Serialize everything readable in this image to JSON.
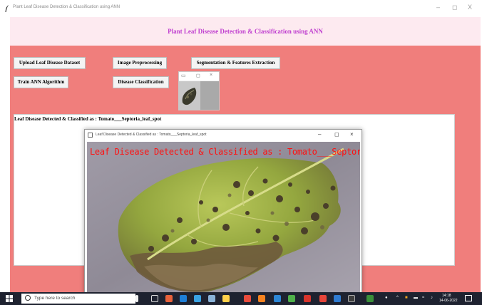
{
  "window": {
    "title": "Plant Leaf Disease Detection & Classification using ANN",
    "minimize": "–",
    "maximize": "◻",
    "close": "X"
  },
  "header": {
    "heading": "Plant Leaf Disease Detection & Classification using ANN"
  },
  "buttons": {
    "upload": "Upload Leaf Disease Dataset",
    "preprocess": "Image Preprocessing",
    "segmentation": "Segmentation & Features Extraction",
    "train": "Train ANN Algorithm",
    "classify": "Disease Classification"
  },
  "result": {
    "label": "Leaf Disease Detected & Classified as : Tomato___Septoria_leaf_spot"
  },
  "mini_window": {
    "minimize": "▭",
    "maximize": "◻",
    "close": "×"
  },
  "image_window": {
    "title": "Leaf Disease Detected & Classified as : Tomato___Septoria_leaf_spot",
    "overlay": "Leaf Disease Detected & Classified as : Tomato___Septoria_leaf_spot",
    "minimize": "–",
    "maximize": "◻",
    "close": "×"
  },
  "taskbar": {
    "search_placeholder": "Type here to search",
    "time": "14:18",
    "date": "14-06-2022"
  },
  "colors": {
    "content_bg": "#f07e7c",
    "header_bg": "#fdeaf0",
    "heading": "#c040d0",
    "overlay_text": "#ff1010",
    "taskbar": "#1e2230"
  },
  "icons": [
    "feather-icon",
    "windows-start-icon",
    "search-icon",
    "notification-icon"
  ]
}
